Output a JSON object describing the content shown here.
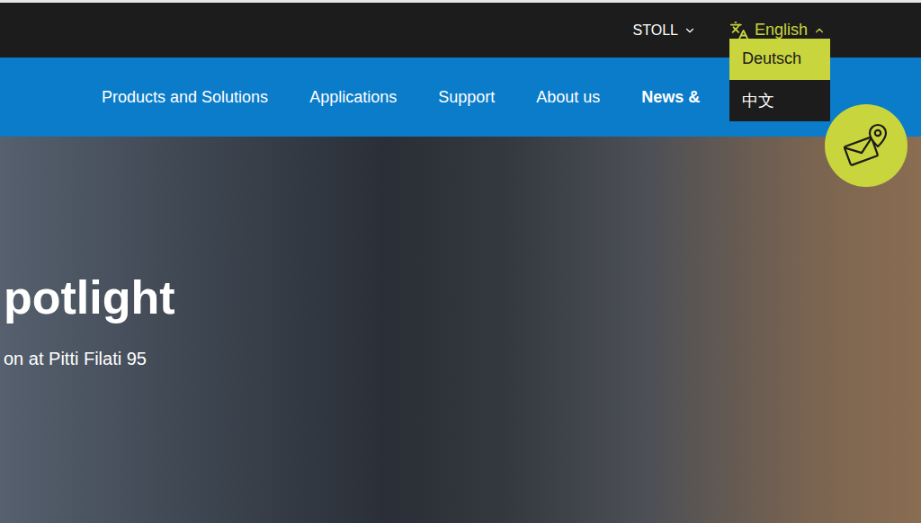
{
  "top_bar": {
    "brand_menu": {
      "label": "STOLL",
      "expanded": false
    },
    "language_menu": {
      "label": "English",
      "expanded": true,
      "options": [
        {
          "label": "Deutsch",
          "highlighted": true
        },
        {
          "label": "中文",
          "highlighted": false
        }
      ]
    }
  },
  "nav": [
    {
      "label": "Products and Solutions",
      "active": false
    },
    {
      "label": "Applications",
      "active": false
    },
    {
      "label": "Support",
      "active": false
    },
    {
      "label": "About us",
      "active": false
    },
    {
      "label": "News &",
      "active": true
    }
  ],
  "hero": {
    "title": "potlight",
    "subtitle": "on at Pitti Filati 95"
  }
}
